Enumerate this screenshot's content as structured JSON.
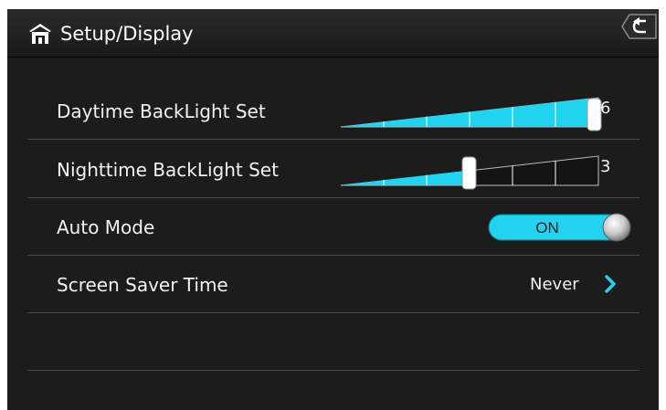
{
  "header": {
    "title": "Setup/Display",
    "home_icon": "home-icon",
    "back_icon": "back-arrow-icon"
  },
  "settings": {
    "daytime_backlight": {
      "label": "Daytime BackLight Set",
      "value": "6",
      "level": 6,
      "max": 6
    },
    "nighttime_backlight": {
      "label": "Nighttime BackLight Set",
      "value": "3",
      "level": 3,
      "max": 6
    },
    "auto_mode": {
      "label": "Auto Mode",
      "state": "ON"
    },
    "screen_saver": {
      "label": "Screen Saver Time",
      "value": "Never",
      "icon": "chevron-right-icon"
    }
  },
  "colors": {
    "accent": "#22d3f0",
    "background": "#1c1c1c",
    "divider": "#4a4a4a"
  }
}
